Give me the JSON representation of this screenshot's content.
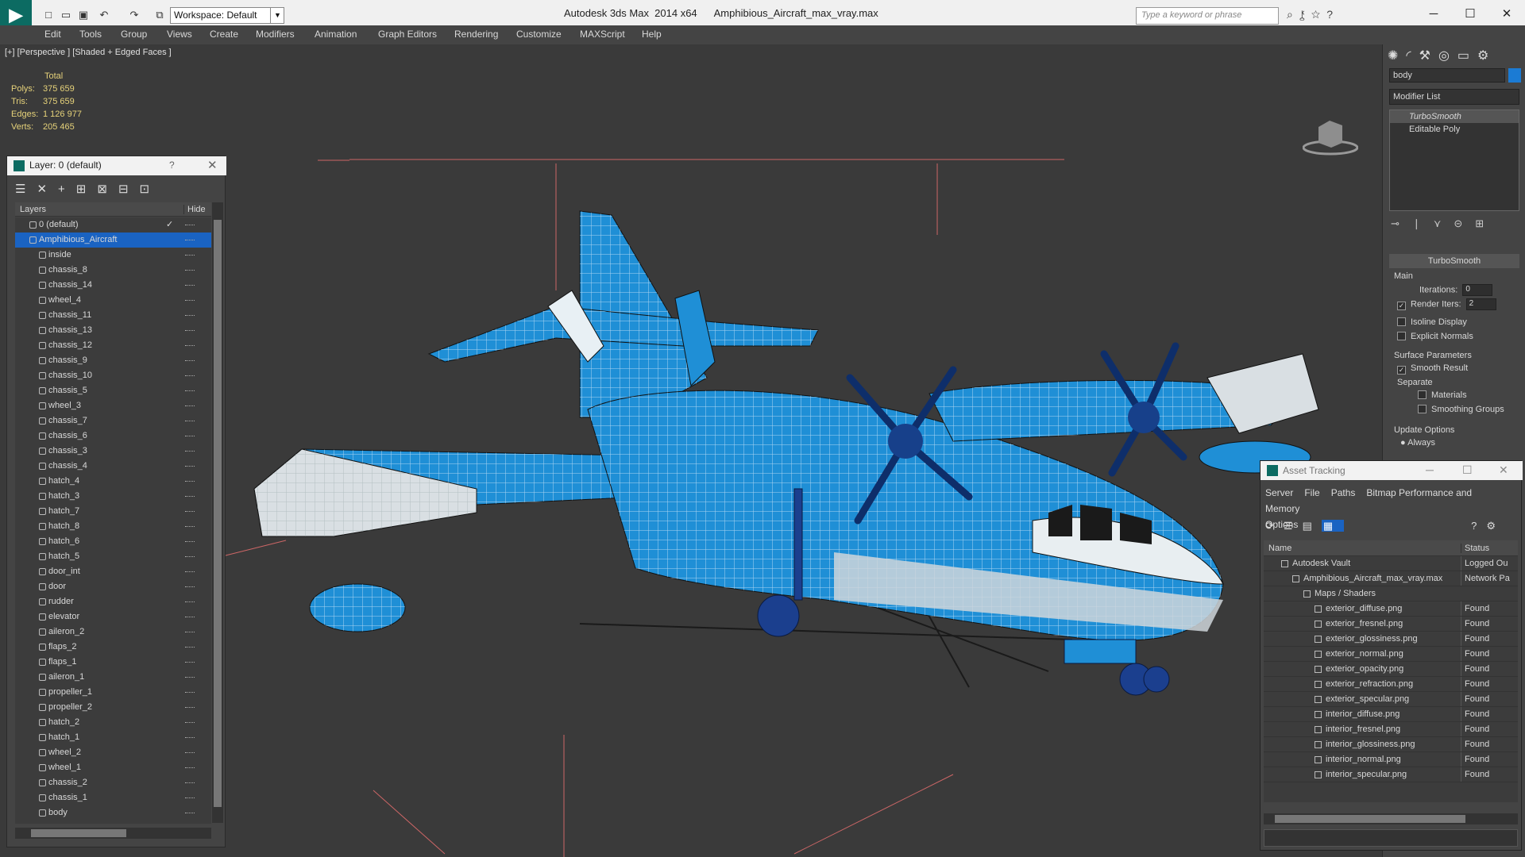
{
  "titlebar": {
    "workspace": "Workspace: Default",
    "app_name": "Autodesk 3ds Max  2014 x64",
    "file_name": "Amphibious_Aircraft_max_vray.max",
    "search_placeholder": "Type a keyword or phrase"
  },
  "menu": [
    "Edit",
    "Tools",
    "Group",
    "Views",
    "Create",
    "Modifiers",
    "Animation",
    "Graph Editors",
    "Rendering",
    "Customize",
    "MAXScript",
    "Help"
  ],
  "viewport": {
    "label": "[+] [Perspective ] [Shaded + Edged Faces ]",
    "stats": {
      "header": "Total",
      "rows": [
        {
          "k": "Polys:",
          "v": "375 659"
        },
        {
          "k": "Tris:",
          "v": "375 659"
        },
        {
          "k": "Edges:",
          "v": "1 126 977"
        },
        {
          "k": "Verts:",
          "v": "205 465"
        }
      ]
    }
  },
  "layer_panel": {
    "title": "Layer: 0 (default)",
    "help": "?",
    "col_layers": "Layers",
    "col_hide": "Hide",
    "layers": [
      "0 (default)",
      "Amphibious_Aircraft",
      "inside",
      "chassis_8",
      "chassis_14",
      "wheel_4",
      "chassis_11",
      "chassis_13",
      "chassis_12",
      "chassis_9",
      "chassis_10",
      "chassis_5",
      "wheel_3",
      "chassis_7",
      "chassis_6",
      "chassis_3",
      "chassis_4",
      "hatch_4",
      "hatch_3",
      "hatch_7",
      "hatch_8",
      "hatch_6",
      "hatch_5",
      "door_int",
      "door",
      "rudder",
      "elevator",
      "aileron_2",
      "flaps_2",
      "flaps_1",
      "aileron_1",
      "propeller_1",
      "propeller_2",
      "hatch_2",
      "hatch_1",
      "wheel_2",
      "wheel_1",
      "chassis_2",
      "chassis_1",
      "body"
    ]
  },
  "command_panel": {
    "object_name": "body",
    "object_color": "#1b7bd4",
    "modifier_list": "Modifier List",
    "stack": [
      "TurboSmooth",
      "Editable Poly"
    ],
    "rollout_title": "TurboSmooth",
    "main_label": "Main",
    "iterations_label": "Iterations:",
    "iterations_value": "0",
    "render_iters_label": "Render Iters:",
    "render_iters_value": "2",
    "isoline": "Isoline Display",
    "explicit_normals": "Explicit Normals",
    "surface_params": "Surface Parameters",
    "smooth_result": "Smooth Result",
    "separate": "Separate",
    "materials": "Materials",
    "smoothing_groups": "Smoothing Groups",
    "update_options": "Update Options",
    "always": "Always"
  },
  "asset_tracking": {
    "title": "Asset Tracking",
    "menu": [
      "Server",
      "File",
      "Paths",
      "Bitmap Performance and Memory",
      "Options"
    ],
    "col_name": "Name",
    "col_status": "Status",
    "rows": [
      {
        "name": "Autodesk Vault",
        "status": "Logged Ou",
        "indent": 1
      },
      {
        "name": "Amphibious_Aircraft_max_vray.max",
        "status": "Network Pa",
        "indent": 2
      },
      {
        "name": "Maps / Shaders",
        "status": "",
        "indent": 3
      },
      {
        "name": "exterior_diffuse.png",
        "status": "Found",
        "indent": 4
      },
      {
        "name": "exterior_fresnel.png",
        "status": "Found",
        "indent": 4
      },
      {
        "name": "exterior_glossiness.png",
        "status": "Found",
        "indent": 4
      },
      {
        "name": "exterior_normal.png",
        "status": "Found",
        "indent": 4
      },
      {
        "name": "exterior_opacity.png",
        "status": "Found",
        "indent": 4
      },
      {
        "name": "exterior_refraction.png",
        "status": "Found",
        "indent": 4
      },
      {
        "name": "exterior_specular.png",
        "status": "Found",
        "indent": 4
      },
      {
        "name": "interior_diffuse.png",
        "status": "Found",
        "indent": 4
      },
      {
        "name": "interior_fresnel.png",
        "status": "Found",
        "indent": 4
      },
      {
        "name": "interior_glossiness.png",
        "status": "Found",
        "indent": 4
      },
      {
        "name": "interior_normal.png",
        "status": "Found",
        "indent": 4
      },
      {
        "name": "interior_specular.png",
        "status": "Found",
        "indent": 4
      }
    ]
  },
  "colors": {
    "accent": "#1a63c2",
    "model_blue": "#1f8fd6",
    "app_teal": "#0c6b62"
  }
}
